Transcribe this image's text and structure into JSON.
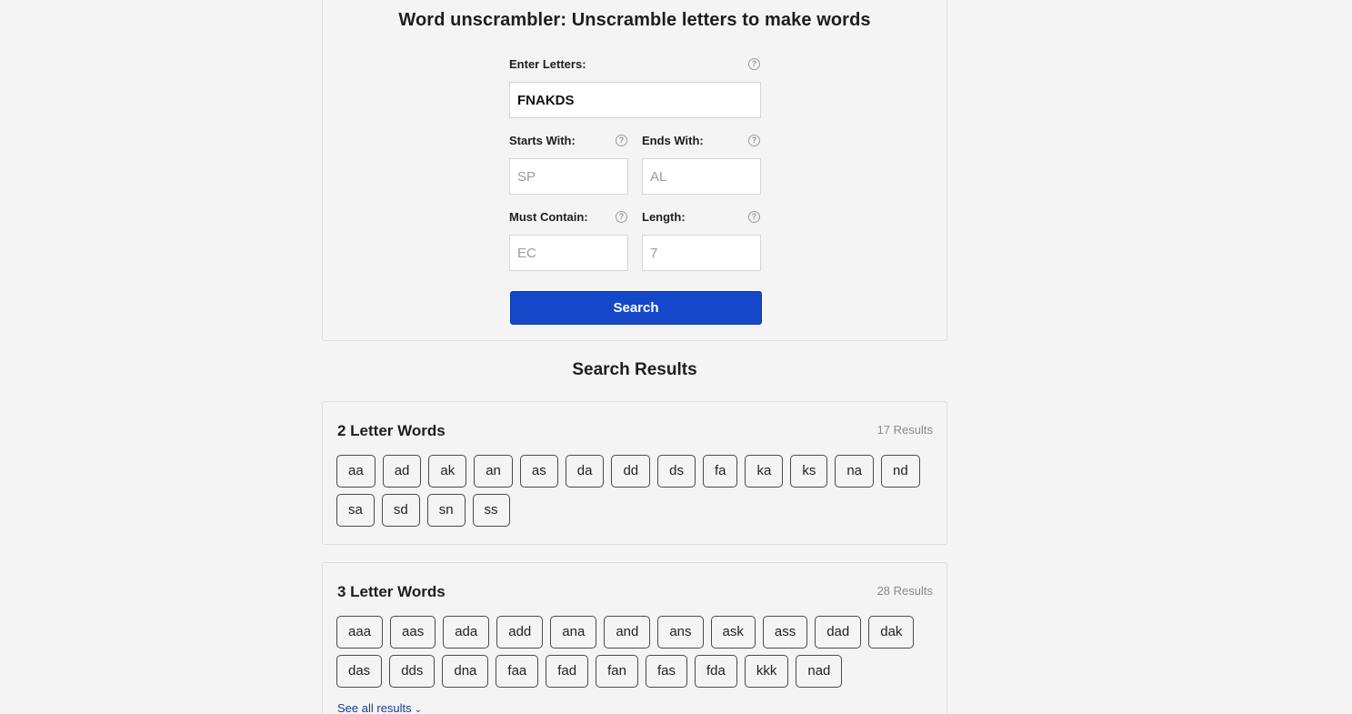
{
  "header": {
    "title": "Word unscrambler: Unscramble letters to make words"
  },
  "form": {
    "letters": {
      "label": "Enter Letters:",
      "value": "FNAKDS",
      "help_icon": "question-circle-icon"
    },
    "starts_with": {
      "label": "Starts With:",
      "placeholder": "SP",
      "value": "",
      "help_icon": "question-circle-icon"
    },
    "ends_with": {
      "label": "Ends With:",
      "placeholder": "AL",
      "value": "",
      "help_icon": "question-circle-icon"
    },
    "must_contain": {
      "label": "Must Contain:",
      "placeholder": "EC",
      "value": "",
      "help_icon": "question-circle-icon"
    },
    "length": {
      "label": "Length:",
      "placeholder": "7",
      "value": "",
      "help_icon": "question-circle-icon"
    },
    "search_label": "Search",
    "accent_color": "#1548c9"
  },
  "results": {
    "title": "Search Results",
    "groups": [
      {
        "title": "2 Letter Words",
        "count": "17 Results",
        "words": [
          "aa",
          "ad",
          "ak",
          "an",
          "as",
          "da",
          "dd",
          "ds",
          "fa",
          "ka",
          "ks",
          "na",
          "nd",
          "sa",
          "sd",
          "sn",
          "ss"
        ]
      },
      {
        "title": "3 Letter Words",
        "count": "28 Results",
        "words": [
          "aaa",
          "aas",
          "ada",
          "add",
          "ana",
          "and",
          "ans",
          "ask",
          "ass",
          "dad",
          "dak",
          "das",
          "dds",
          "dna",
          "faa",
          "fad",
          "fan",
          "fas",
          "fda",
          "kkk",
          "nad"
        ],
        "see_all": "See all results"
      }
    ]
  }
}
